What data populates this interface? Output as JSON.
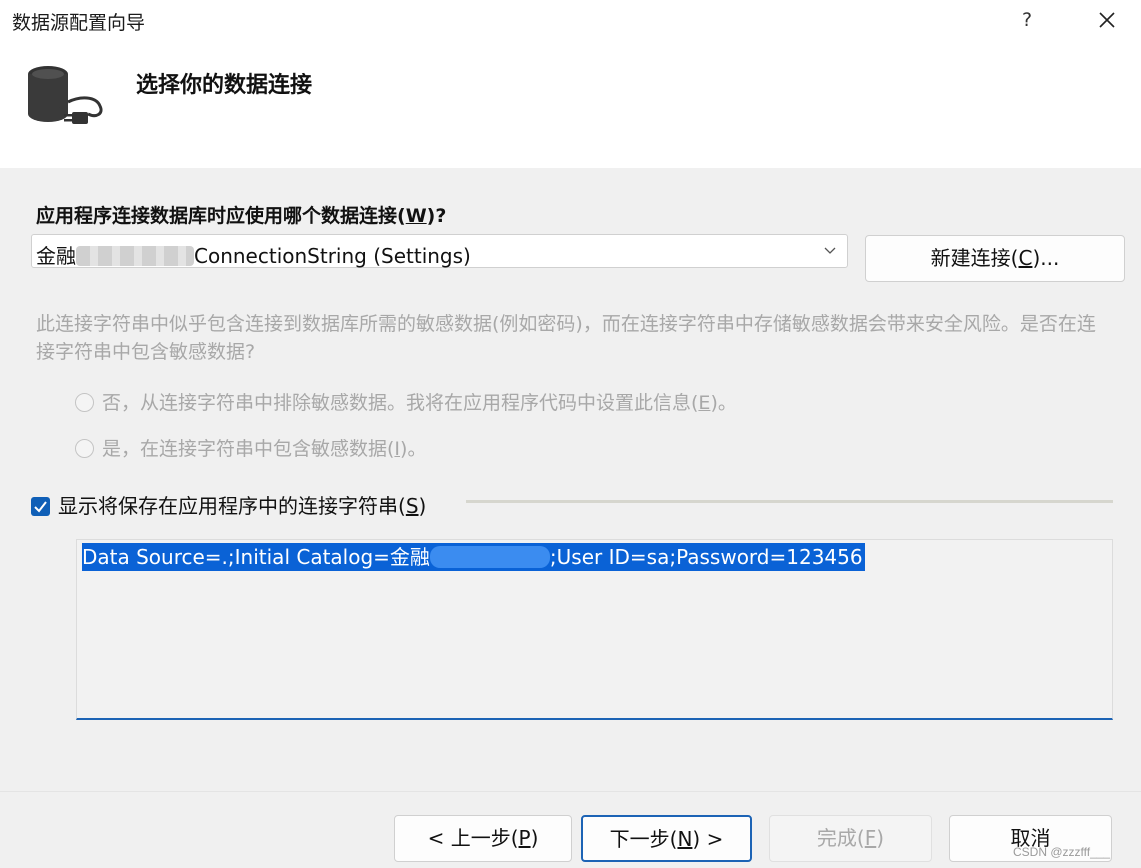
{
  "window": {
    "title": "数据源配置向导",
    "help_label": "?"
  },
  "header": {
    "title": "选择你的数据连接",
    "icon": "database-connection-icon"
  },
  "connection": {
    "question_prefix": "应用程序连接数据库时应使用哪个数据连接(",
    "question_key": "W",
    "question_suffix": ")?",
    "selected_prefix": "金融",
    "selected_suffix": "ConnectionString (Settings)",
    "new_button_prefix": "新建连接(",
    "new_button_key": "C",
    "new_button_suffix": ")..."
  },
  "sensitive": {
    "info_text": "此连接字符串中似乎包含连接到数据库所需的敏感数据(例如密码)，而在连接字符串中存储敏感数据会带来安全风险。是否在连接字符串中包含敏感数据?",
    "exclude_prefix": "否，从连接字符串中排除敏感数据。我将在应用程序代码中设置此信息(",
    "exclude_key": "E",
    "exclude_suffix": ")。",
    "include_prefix": "是，在连接字符串中包含敏感数据(",
    "include_key": "I",
    "include_suffix": ")。"
  },
  "show_string": {
    "label_prefix": "显示将保存在应用程序中的连接字符串(",
    "label_key": "S",
    "label_suffix": ")",
    "checked": true,
    "value_prefix": "Data Source=.;Initial Catalog=金融",
    "value_suffix": ";User ID=sa;Password=123456"
  },
  "footer": {
    "back_prefix": "< 上一步(",
    "back_key": "P",
    "back_suffix": ")",
    "next_prefix": "下一步(",
    "next_key": "N",
    "next_suffix": ") >",
    "finish_prefix": "完成(",
    "finish_key": "F",
    "finish_suffix": ")",
    "cancel_label": "取消"
  },
  "watermark": "CSDN @zzzfff___",
  "colors": {
    "accent": "#0f5fb7",
    "selection": "#0a62d6",
    "disabled_text": "#a8a8a8"
  }
}
